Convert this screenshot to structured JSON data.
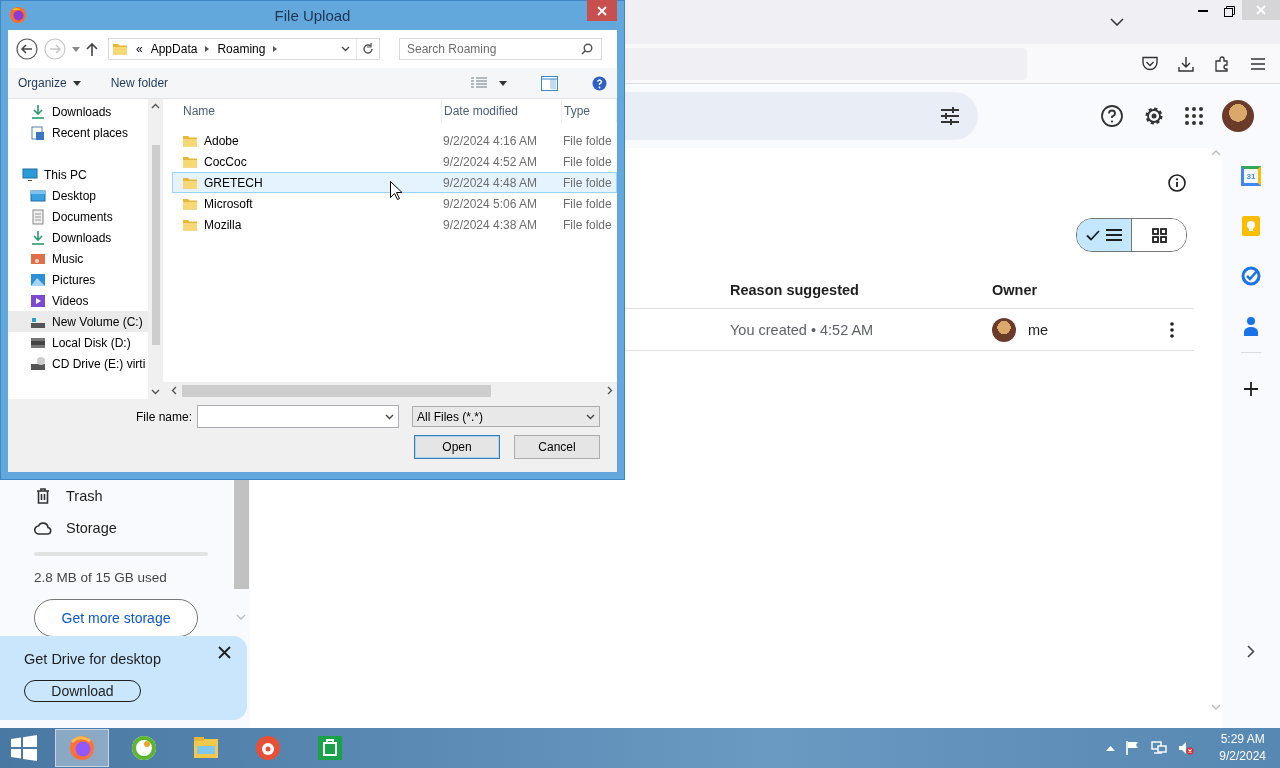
{
  "dialog": {
    "title": "File Upload",
    "address": {
      "overflow": "«",
      "parts": [
        "AppData",
        "Roaming"
      ]
    },
    "search": {
      "placeholder": "Search Roaming"
    },
    "commands": [
      {
        "label": "Organize",
        "kind": "menu"
      },
      {
        "label": "New folder",
        "kind": "plain"
      }
    ],
    "nav_tree": [
      {
        "label": "Downloads",
        "kind": "download",
        "selected": false
      },
      {
        "label": "Recent places",
        "kind": "recent",
        "selected": false
      },
      {
        "label": "This PC",
        "kind": "pc",
        "selected": false,
        "children": [
          {
            "label": "Desktop",
            "kind": "desktop",
            "selected": false
          },
          {
            "label": "Documents",
            "kind": "documents",
            "selected": false
          },
          {
            "label": "Downloads",
            "kind": "download",
            "selected": false
          },
          {
            "label": "Music",
            "kind": "music",
            "selected": false
          },
          {
            "label": "Pictures",
            "kind": "pictures",
            "selected": false
          },
          {
            "label": "Videos",
            "kind": "videos",
            "selected": false
          },
          {
            "label": "New Volume (C:)",
            "kind": "system-drive",
            "selected": true
          },
          {
            "label": "Local Disk (D:)",
            "kind": "drive",
            "selected": false
          },
          {
            "label": "CD Drive (E:) virti",
            "kind": "cd",
            "selected": false
          }
        ]
      }
    ],
    "columns": [
      "Name",
      "Date modified",
      "Type"
    ],
    "files": [
      {
        "name": "Adobe",
        "date": "9/2/2024 4:16 AM",
        "type": "File folde",
        "selected": false
      },
      {
        "name": "CocCoc",
        "date": "9/2/2024 4:52 AM",
        "type": "File folde",
        "selected": false
      },
      {
        "name": "GRETECH",
        "date": "9/2/2024 4:48 AM",
        "type": "File folde",
        "selected": true
      },
      {
        "name": "Microsoft",
        "date": "9/2/2024 5:06 AM",
        "type": "File folde",
        "selected": false
      },
      {
        "name": "Mozilla",
        "date": "9/2/2024 4:38 AM",
        "type": "File folde",
        "selected": false
      }
    ],
    "file_name": {
      "label": "File name:"
    },
    "filter": "All Files (*.*)",
    "buttons": [
      {
        "label": "Open",
        "default": true
      },
      {
        "label": "Cancel",
        "default": false
      }
    ]
  },
  "drive": {
    "view_toggle": [
      {
        "kind": "list",
        "selected": true
      },
      {
        "kind": "grid",
        "selected": false
      }
    ],
    "table": {
      "columns": [
        "Reason suggested",
        "Owner"
      ],
      "rows": [
        {
          "reason": "You created • 4:52 AM",
          "owner": "me"
        }
      ]
    },
    "sidebar": {
      "items": [
        {
          "label": "Trash",
          "kind": "trash"
        },
        {
          "label": "Storage",
          "kind": "cloud"
        }
      ],
      "storage": {
        "level": 0.0002,
        "text": "2.8 MB of 15 GB used",
        "button": "Get more storage"
      }
    },
    "promo": {
      "title": "Get Drive for desktop",
      "button": "Download"
    },
    "side_panel": {
      "calendar_day": "31"
    }
  },
  "taskbar": {
    "apps": [
      {
        "kind": "firefox",
        "selected": true
      },
      {
        "kind": "coccoc",
        "selected": false
      },
      {
        "kind": "explorer",
        "selected": false
      },
      {
        "kind": "player",
        "selected": false
      },
      {
        "kind": "store",
        "selected": false
      }
    ],
    "time": "5:29 AM",
    "date": "9/2/2024"
  }
}
